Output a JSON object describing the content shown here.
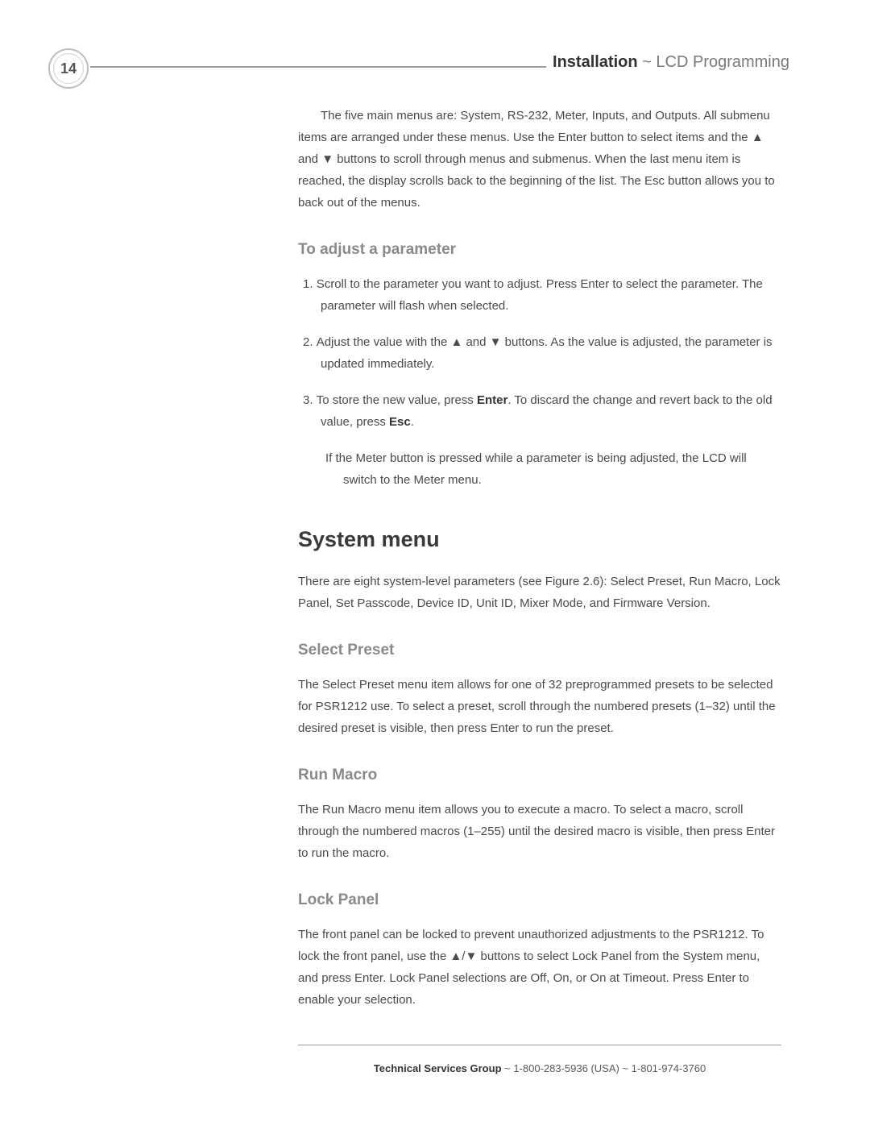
{
  "page_number": "14",
  "header": {
    "part1": "Installation",
    "sep": " ~ ",
    "part2": "LCD Programming"
  },
  "intro": "The five main menus are: System, RS-232, Meter, Inputs, and Outputs. All submenu items are arranged under these menus. Use the Enter button to select items and the ▲ and ▼ buttons to scroll through menus and submenus. When the last menu item is reached, the display scrolls back to the beginning of the list. The Esc button allows you to back out of the menus.",
  "h3_adjust": "To adjust a parameter",
  "steps": {
    "s1": "Scroll to the parameter you want to adjust. Press Enter to select the parameter. The parameter will flash when selected.",
    "s2": "Adjust the value with the ▲ and ▼ buttons. As the value is adjusted, the parameter is updated immediately.",
    "s3_pre": "To store the new value, press ",
    "s3_enter": "Enter",
    "s3_mid": ". To discard the change and revert back to the old value, press ",
    "s3_esc": "Esc",
    "s3_post": ".",
    "s3_extra": "If the Meter button is pressed while a parameter is being adjusted, the LCD will switch to the Meter menu."
  },
  "h2_system": "System menu",
  "system_intro": "There are eight system-level parameters (see Figure 2.6): Select Preset, Run Macro, Lock Panel, Set Passcode, Device ID, Unit ID, Mixer Mode, and Firmware Version.",
  "h3_select_preset": "Select Preset",
  "select_preset_body": "The Select Preset menu item allows for one of 32 preprogrammed presets to be selected for PSR1212 use. To select a preset, scroll through the numbered presets (1–32) until the desired preset is visible, then press Enter to run the preset.",
  "h3_run_macro": "Run Macro",
  "run_macro_body": "The Run Macro menu item allows you to execute a macro. To select a macro, scroll through the numbered macros (1–255) until the desired macro is visible, then press Enter to run the macro.",
  "h3_lock_panel": "Lock Panel",
  "lock_panel_body": "The front panel can be locked to prevent unauthorized adjustments to the PSR1212. To lock the front panel, use the ▲/▼ buttons to select Lock Panel from the System menu, and press Enter. Lock Panel selections are Off, On, or On at Timeout. Press Enter to enable your selection.",
  "footer": {
    "group": "Technical Services Group",
    "rest": " ~ 1-800-283-5936 (USA) ~ 1-801-974-3760"
  }
}
